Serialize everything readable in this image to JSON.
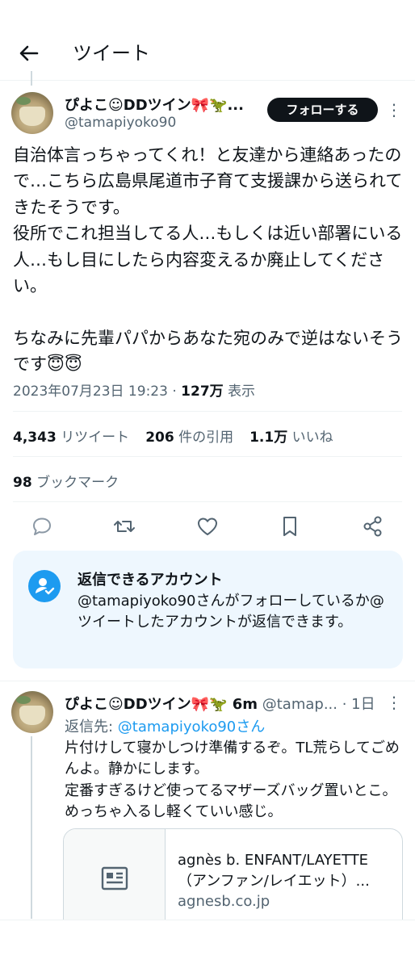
{
  "header": {
    "title": "ツイート"
  },
  "tweet": {
    "display_name": "ぴよこ☺DDツイン🎀🦖...",
    "handle": "@tamapiyoko90",
    "follow_label": "フォローする",
    "text": "自治体言っちゃってくれ！と友達から連絡あったので…こちら広島県尾道市子育て支援課から送られてきたそうです。\n役所でこれ担当してる人…もしくは近い部署にいる人…もし目にしたら内容変えるか廃止してください。\n\nちなみに先輩パパからあなた宛のみで逆はないそうです😇😇",
    "datetime": "2023年07月23日 19:23",
    "dot": "·",
    "views_count": "127万",
    "views_label": "表示",
    "retweets_count": "4,343",
    "retweets_label": "リツイート",
    "quotes_count": "206",
    "quotes_label": "件の引用",
    "likes_count": "1.1万",
    "likes_label": "いいね",
    "bookmarks_count": "98",
    "bookmarks_label": "ブックマーク"
  },
  "reply_restriction": {
    "title": "返信できるアカウント",
    "body": "@tamapiyoko90さんがフォローしているか@ツイートしたアカウントが返信できます。"
  },
  "reply": {
    "display_name": "ぴよこ☺DDツイン🎀🦖 6m",
    "handle_time": " @tamap... · 1日",
    "reply_to_label": "返信先: ",
    "reply_to_handle": "@tamapiyoko90さん",
    "text": "片付けして寝かしつけ準備するぞ。TL荒らしてごめんよ。静かにします。\n定番すぎるけど使ってるマザーズバッグ置いとこ。めっちゃ入るし軽くていい感じ。",
    "card_title_1": "agnès b. ENFANT/LAYETTE",
    "card_title_2": "（アンファン/レイエット）...",
    "card_domain": "agnesb.co.jp"
  },
  "colors": {
    "accent": "#1d9bf0",
    "text": "#0f1419",
    "secondary": "#536471"
  }
}
